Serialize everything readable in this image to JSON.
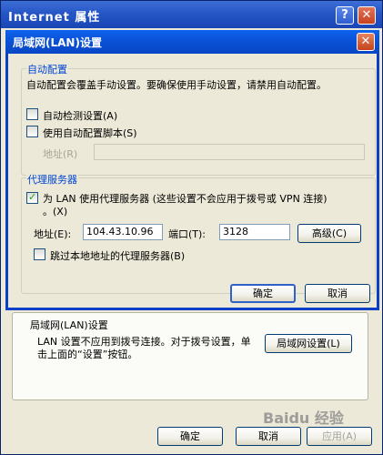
{
  "internet_properties": {
    "title": "Internet 属性",
    "help_glyph": "?",
    "close_glyph": "✕",
    "lan_group_title": "局域网(LAN)设置",
    "lan_desc": "LAN 设置不应用到拨号连接。对于拨号设置，单击上面的“设置”按钮。",
    "lan_settings_button": "局域网设置(L)",
    "ok": "确定",
    "cancel": "取消",
    "apply": "应用(A)",
    "watermark": "Baidu 经验"
  },
  "lan_dialog": {
    "title": "局域网(LAN)设置",
    "close_glyph": "✕",
    "auto_config": {
      "group_title": "自动配置",
      "description": "自动配置会覆盖手动设置。要确保使用手动设置，请禁用自动配置。",
      "auto_detect_label": "自动检测设置(A)",
      "auto_detect_checked": false,
      "auto_script_label": "使用自动配置脚本(S)",
      "auto_script_checked": false,
      "address_label": "地址(R)",
      "address_value": ""
    },
    "proxy": {
      "group_title": "代理服务器",
      "use_proxy_label_1": "为 LAN 使用代理服务器 (这些设置不会应用于拨号或 VPN 连接)",
      "use_proxy_label_2": "。(X)",
      "use_proxy_checked": true,
      "address_label": "地址(E):",
      "address_value": "104.43.10.96",
      "port_label": "端口(T):",
      "port_value": "3128",
      "advanced_button": "高级(C)",
      "bypass_label": "跳过本地地址的代理服务器(B)",
      "bypass_checked": false
    },
    "ok": "确定",
    "cancel": "取消"
  },
  "colors": {
    "title_bar": "#0a52d8",
    "group_title": "#0046d5",
    "checkmark": "#21a121"
  }
}
